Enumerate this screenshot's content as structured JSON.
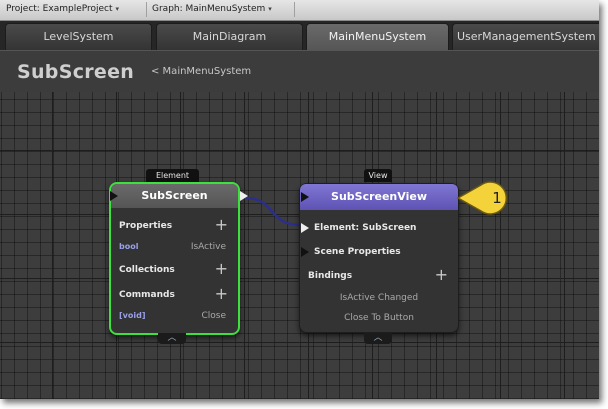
{
  "toolbar": {
    "project_dropdown": "Project: ExampleProject",
    "graph_dropdown": "Graph: MainMenuSystem",
    "caret": "▾"
  },
  "tabs": [
    {
      "label": "LevelSystem",
      "active": false
    },
    {
      "label": "MainDiagram",
      "active": false
    },
    {
      "label": "MainMenuSystem",
      "active": true
    },
    {
      "label": "UserManagementSystem",
      "active": false
    }
  ],
  "header": {
    "title": "SubScreen",
    "breadcrumb": "< MainMenuSystem"
  },
  "element_node": {
    "tag": "Element",
    "title": "SubScreen",
    "properties_label": "Properties",
    "property": {
      "type": "bool",
      "name": "IsActive"
    },
    "collections_label": "Collections",
    "commands_label": "Commands",
    "command": {
      "type": "[void]",
      "name": "Close"
    },
    "plus": "+",
    "collapse": "︿",
    "border_color": "#3ee03e",
    "header_color": "#5e5e5e"
  },
  "view_node": {
    "tag": "View",
    "title": "SubScreenView",
    "element_row": "Element: SubScreen",
    "scene_properties": "Scene Properties",
    "bindings_label": "Bindings",
    "binding_1": "IsActive Changed",
    "binding_2": "Close To Button",
    "plus": "+",
    "collapse": "︿",
    "header_color": "#6a5fbf"
  },
  "callout": {
    "number": "1",
    "color": "#f3d23a"
  }
}
